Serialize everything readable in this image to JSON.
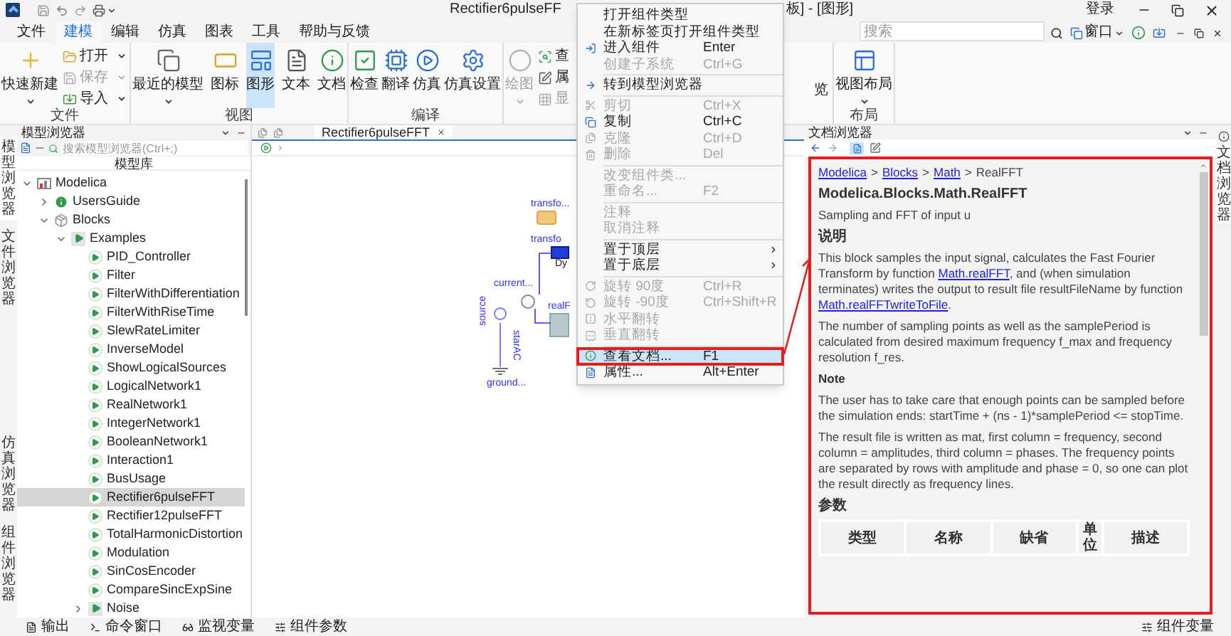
{
  "title_bar": {
    "title": "Rectifier6pulseFF",
    "title_end": "板] - [图形]",
    "login": "登录"
  },
  "menu_tabs": [
    {
      "label": "文件",
      "selected": false
    },
    {
      "label": "建模",
      "selected": true
    },
    {
      "label": "编辑",
      "selected": false
    },
    {
      "label": "仿真",
      "selected": false
    },
    {
      "label": "图表",
      "selected": false
    },
    {
      "label": "工具",
      "selected": false
    },
    {
      "label": "帮助与反馈",
      "selected": false
    }
  ],
  "search": {
    "placeholder": "搜索"
  },
  "window_menu": {
    "label": "窗口"
  },
  "ribbon": [
    {
      "title": "文件",
      "buttons": [
        {
          "label": "快速新建",
          "kind": "large",
          "dropdown": true,
          "disabled": false,
          "selected": false
        },
        {
          "label": "打开",
          "kind": "small",
          "dropdown": true,
          "disabled": false,
          "selected": false
        },
        {
          "label": "保存",
          "kind": "small",
          "dropdown": true,
          "disabled": true,
          "selected": false
        },
        {
          "label": "导入",
          "kind": "small",
          "dropdown": true,
          "disabled": false,
          "selected": false
        }
      ]
    },
    {
      "title": "视图",
      "buttons": [
        {
          "label": "最近的模型",
          "kind": "large",
          "dropdown": true,
          "disabled": false,
          "selected": false
        },
        {
          "label": "图标",
          "kind": "large",
          "dropdown": false,
          "disabled": false,
          "selected": false
        },
        {
          "label": "图形",
          "kind": "large",
          "dropdown": false,
          "disabled": false,
          "selected": true
        },
        {
          "label": "文本",
          "kind": "large",
          "dropdown": false,
          "disabled": false,
          "selected": false
        },
        {
          "label": "文档",
          "kind": "large",
          "dropdown": false,
          "disabled": false,
          "selected": false
        }
      ]
    },
    {
      "title": "编译",
      "buttons": [
        {
          "label": "检查",
          "kind": "large",
          "dropdown": false,
          "disabled": false,
          "selected": false
        },
        {
          "label": "翻译",
          "kind": "large",
          "dropdown": false,
          "disabled": false,
          "selected": false
        },
        {
          "label": "仿真",
          "kind": "large",
          "dropdown": false,
          "disabled": false,
          "selected": false
        },
        {
          "label": "仿真设置",
          "kind": "large",
          "dropdown": false,
          "disabled": false,
          "selected": false
        }
      ]
    },
    {
      "buttons": [
        {
          "label": "绘图",
          "kind": "large",
          "dropdown": true,
          "disabled": true,
          "selected": false
        },
        {
          "label": "查",
          "kind": "small",
          "dropdown": false,
          "disabled": false,
          "selected": false
        },
        {
          "label": "属",
          "kind": "small",
          "dropdown": false,
          "disabled": false,
          "selected": false
        },
        {
          "label": "显",
          "kind": "small",
          "dropdown": false,
          "disabled": true,
          "selected": false
        },
        {
          "label": "览",
          "kind": "fragment",
          "dropdown": false,
          "disabled": false,
          "selected": false
        }
      ]
    },
    {
      "title": "布局",
      "buttons": [
        {
          "label": "视图布局",
          "kind": "large",
          "dropdown": true,
          "disabled": false,
          "selected": false
        }
      ]
    }
  ],
  "side_tabs": [
    {
      "label": "模型浏览器",
      "selected": true
    },
    {
      "label": "文件浏览器",
      "selected": false
    },
    {
      "label": "仿真浏览器",
      "selected": false
    },
    {
      "label": "组件浏览器",
      "selected": false
    }
  ],
  "model_browser": {
    "title": "模型浏览器",
    "search_placeholder": "搜索模型浏览器(Ctrl+;)",
    "header": "模型库",
    "tree": [
      {
        "label": "Modelica",
        "kind": "library",
        "expanded": true,
        "selected": false,
        "children": [
          {
            "label": "UsersGuide",
            "kind": "info",
            "expanded": false,
            "selected": false
          },
          {
            "label": "Blocks",
            "kind": "package",
            "expanded": true,
            "selected": false,
            "children": [
              {
                "label": "Examples",
                "kind": "examples",
                "expanded": true,
                "selected": false,
                "children": [
                  {
                    "label": "PID_Controller",
                    "kind": "model",
                    "selected": false
                  },
                  {
                    "label": "Filter",
                    "kind": "model",
                    "selected": false
                  },
                  {
                    "label": "FilterWithDifferentiation",
                    "kind": "model",
                    "selected": false
                  },
                  {
                    "label": "FilterWithRiseTime",
                    "kind": "model",
                    "selected": false
                  },
                  {
                    "label": "SlewRateLimiter",
                    "kind": "model",
                    "selected": false
                  },
                  {
                    "label": "InverseModel",
                    "kind": "model",
                    "selected": false
                  },
                  {
                    "label": "ShowLogicalSources",
                    "kind": "model",
                    "selected": false
                  },
                  {
                    "label": "LogicalNetwork1",
                    "kind": "model",
                    "selected": false
                  },
                  {
                    "label": "RealNetwork1",
                    "kind": "model",
                    "selected": false
                  },
                  {
                    "label": "IntegerNetwork1",
                    "kind": "model",
                    "selected": false
                  },
                  {
                    "label": "BooleanNetwork1",
                    "kind": "model",
                    "selected": false
                  },
                  {
                    "label": "Interaction1",
                    "kind": "model",
                    "selected": false
                  },
                  {
                    "label": "BusUsage",
                    "kind": "model",
                    "selected": false
                  },
                  {
                    "label": "Rectifier6pulseFFT",
                    "kind": "model",
                    "selected": true
                  },
                  {
                    "label": "Rectifier12pulseFFT",
                    "kind": "model",
                    "selected": false
                  },
                  {
                    "label": "TotalHarmonicDistortion",
                    "kind": "model",
                    "selected": false
                  },
                  {
                    "label": "Modulation",
                    "kind": "model",
                    "selected": false
                  },
                  {
                    "label": "SinCosEncoder",
                    "kind": "model",
                    "selected": false
                  },
                  {
                    "label": "CompareSincExpSine",
                    "kind": "model",
                    "selected": false
                  },
                  {
                    "label": "Noise",
                    "kind": "examples",
                    "expanded": false,
                    "selected": false
                  }
                ]
              }
            ]
          }
        ]
      }
    ]
  },
  "editor_tabs": [
    {
      "label": "Rectifier6pulseFFT",
      "selected": true
    }
  ],
  "diagram": {
    "labels": [
      "transfo...",
      "transfo",
      "Dy",
      "current...",
      "realF",
      "source",
      "starAC",
      "ground..."
    ]
  },
  "context_menu": [
    {
      "kind": "item",
      "label": "打开组件类型",
      "disabled": false,
      "selected": false,
      "submenu": false
    },
    {
      "kind": "item",
      "label": "在新标签页打开组件类型",
      "disabled": false,
      "selected": false,
      "submenu": false
    },
    {
      "kind": "item",
      "label": "进入组件",
      "shortcut": "Enter",
      "disabled": false,
      "selected": false,
      "submenu": false
    },
    {
      "kind": "item",
      "label": "创建子系统",
      "shortcut": "Ctrl+G",
      "disabled": true,
      "selected": false,
      "submenu": false
    },
    {
      "kind": "separator"
    },
    {
      "kind": "item",
      "label": "转到模型浏览器",
      "disabled": false,
      "selected": false,
      "submenu": false
    },
    {
      "kind": "separator"
    },
    {
      "kind": "item",
      "label": "剪切",
      "shortcut": "Ctrl+X",
      "disabled": true,
      "selected": false,
      "submenu": false
    },
    {
      "kind": "item",
      "label": "复制",
      "shortcut": "Ctrl+C",
      "disabled": false,
      "selected": false,
      "submenu": false
    },
    {
      "kind": "item",
      "label": "克隆",
      "shortcut": "Ctrl+D",
      "disabled": true,
      "selected": false,
      "submenu": false
    },
    {
      "kind": "item",
      "label": "删除",
      "shortcut": "Del",
      "disabled": true,
      "selected": false,
      "submenu": false
    },
    {
      "kind": "separator"
    },
    {
      "kind": "item",
      "label": "改变组件类...",
      "disabled": true,
      "selected": false,
      "submenu": false
    },
    {
      "kind": "item",
      "label": "重命名...",
      "shortcut": "F2",
      "disabled": true,
      "selected": false,
      "submenu": false
    },
    {
      "kind": "separator"
    },
    {
      "kind": "item",
      "label": "注释",
      "disabled": true,
      "selected": false,
      "submenu": false
    },
    {
      "kind": "item",
      "label": "取消注释",
      "disabled": true,
      "selected": false,
      "submenu": false
    },
    {
      "kind": "separator"
    },
    {
      "kind": "item",
      "label": "置于顶层",
      "disabled": false,
      "selected": false,
      "submenu": true
    },
    {
      "kind": "item",
      "label": "置于底层",
      "disabled": false,
      "selected": false,
      "submenu": true
    },
    {
      "kind": "separator"
    },
    {
      "kind": "item",
      "label": "旋转 90度",
      "shortcut": "Ctrl+R",
      "disabled": true,
      "selected": false,
      "submenu": false
    },
    {
      "kind": "item",
      "label": "旋转 -90度",
      "shortcut": "Ctrl+Shift+R",
      "disabled": true,
      "selected": false,
      "submenu": false
    },
    {
      "kind": "item",
      "label": "水平翻转",
      "disabled": true,
      "selected": false,
      "submenu": false
    },
    {
      "kind": "item",
      "label": "垂直翻转",
      "disabled": true,
      "selected": false,
      "submenu": false
    },
    {
      "kind": "separator"
    },
    {
      "kind": "item",
      "label": "查看文档...",
      "shortcut": "F1",
      "disabled": false,
      "selected": true,
      "submenu": false
    },
    {
      "kind": "item",
      "label": "属性...",
      "shortcut": "Alt+Enter",
      "disabled": false,
      "selected": false,
      "submenu": false
    }
  ],
  "doc_browser": {
    "title": "文档浏览器",
    "side_label": "文档浏览器",
    "highlighted": true,
    "breadcrumb": [
      {
        "text": "Modelica",
        "link": true
      },
      {
        "text": ">",
        "link": false
      },
      {
        "text": "Blocks",
        "link": true
      },
      {
        "text": ">",
        "link": false
      },
      {
        "text": "Math",
        "link": true
      },
      {
        "text": ">",
        "link": false
      },
      {
        "text": "RealFFT",
        "link": false
      }
    ],
    "content": [
      {
        "kind": "title",
        "segments": [
          {
            "text": "Modelica.Blocks.Math.RealFFT",
            "link": false
          }
        ]
      },
      {
        "kind": "paragraph",
        "segments": [
          {
            "text": "Sampling and FFT of input u",
            "link": false
          }
        ]
      },
      {
        "kind": "heading",
        "segments": [
          {
            "text": "说明",
            "link": false
          }
        ]
      },
      {
        "kind": "paragraph",
        "segments": [
          {
            "text": "This block samples the input signal, calculates the Fast Fourier Transform by function ",
            "link": false
          },
          {
            "text": "Math.realFFT",
            "link": true
          },
          {
            "text": ", and (when simulation terminates) writes the output to result file resultFileName by function ",
            "link": false
          },
          {
            "text": "Math.realFFTwriteToFile",
            "link": true
          },
          {
            "text": ".",
            "link": false
          }
        ]
      },
      {
        "kind": "paragraph",
        "segments": [
          {
            "text": "The number of sampling points as well as the samplePeriod is calculated from desired maximum frequency f_max and frequency resolution f_res.",
            "link": false
          }
        ]
      },
      {
        "kind": "subheading",
        "segments": [
          {
            "text": "Note",
            "link": false
          }
        ]
      },
      {
        "kind": "paragraph",
        "segments": [
          {
            "text": "The user has to take care that enough points can be sampled before the simulation ends: startTime + (ns - 1)*samplePeriod <= stopTime.",
            "link": false
          }
        ]
      },
      {
        "kind": "paragraph",
        "segments": [
          {
            "text": "The result file is written as mat, first column = frequency, second column = amplitudes, third column = phases. The frequency points are separated by rows with amplitude and phase = 0, so one can plot the result directly as frequency lines.",
            "link": false
          }
        ]
      },
      {
        "kind": "heading",
        "segments": [
          {
            "text": "参数",
            "link": false
          }
        ]
      }
    ],
    "table_columns": [
      "类型",
      "名称",
      "缺省",
      "单位",
      "描述"
    ]
  },
  "bottom_tabs": [
    {
      "label": "输出"
    },
    {
      "label": "命令窗口"
    },
    {
      "label": "监视变量"
    },
    {
      "label": "组件参数"
    }
  ],
  "bottom_right": {
    "label": "组件变量"
  }
}
